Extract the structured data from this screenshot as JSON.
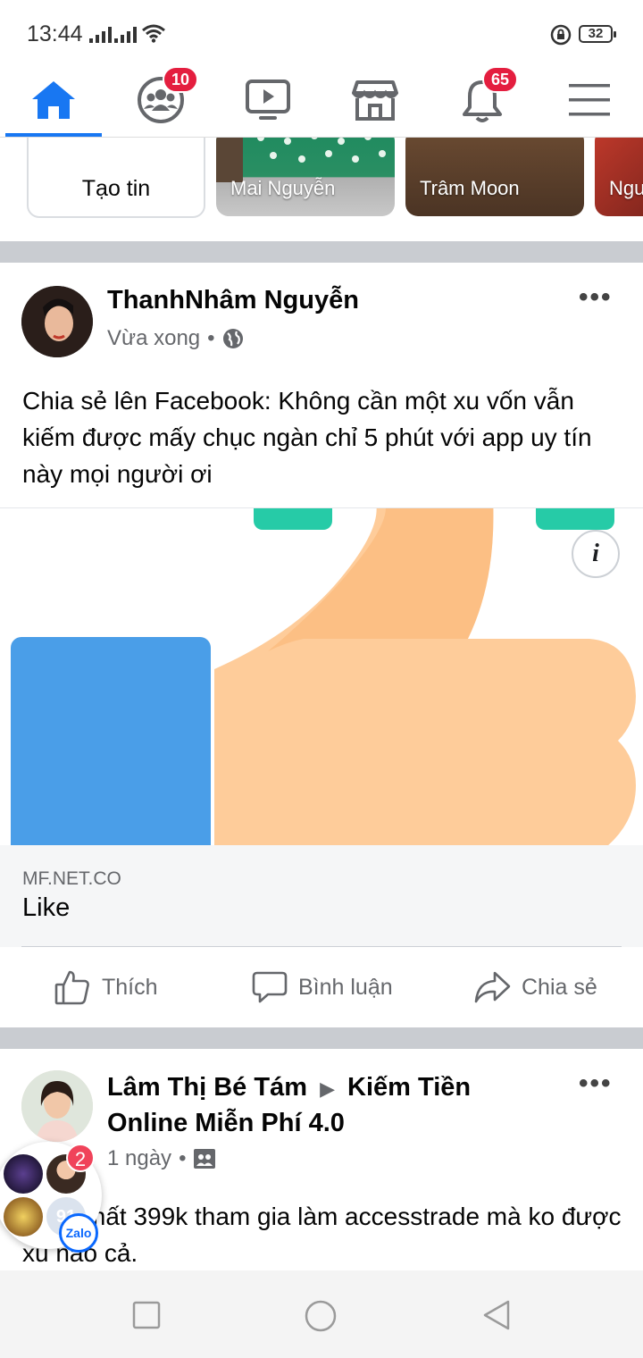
{
  "status_bar": {
    "time": "13:44",
    "battery": "32"
  },
  "nav": {
    "badges": {
      "groups": "10",
      "notifications": "65"
    }
  },
  "stories": {
    "create_label": "Tạo tin",
    "items": [
      {
        "name": "Mai Nguyễn"
      },
      {
        "name": "Trâm Moon"
      },
      {
        "name": "Ngu"
      }
    ]
  },
  "post1": {
    "author": "ThanhNhâm Nguyễn",
    "time": "Vừa xong",
    "text": "Chia sẻ lên Facebook: Không cần một xu vốn vẫn kiếm được mấy chục ngàn chỉ 5 phút với app uy tín này mọi người ơi",
    "link_domain": "MF.NET.CO",
    "link_title": "Like",
    "info_label": "i"
  },
  "actions": {
    "like": "Thích",
    "comment": "Bình luận",
    "share": "Chia sẻ"
  },
  "post2": {
    "author": "Lâm Thị Bé Tám",
    "group_line1": "Kiếm Tiền",
    "group_line2": "Online Miễn Phí 4.0",
    "time": "1 ngày",
    "text": "Mình mất 399k  tham gia làm accesstrade mà ko được xu nào cả."
  },
  "zalo": {
    "badge": "2",
    "count": "91",
    "label": "Zalo"
  },
  "colors": {
    "brand": "#1877f2",
    "badge": "#e41e3f",
    "separator": "#c9ccd1"
  }
}
